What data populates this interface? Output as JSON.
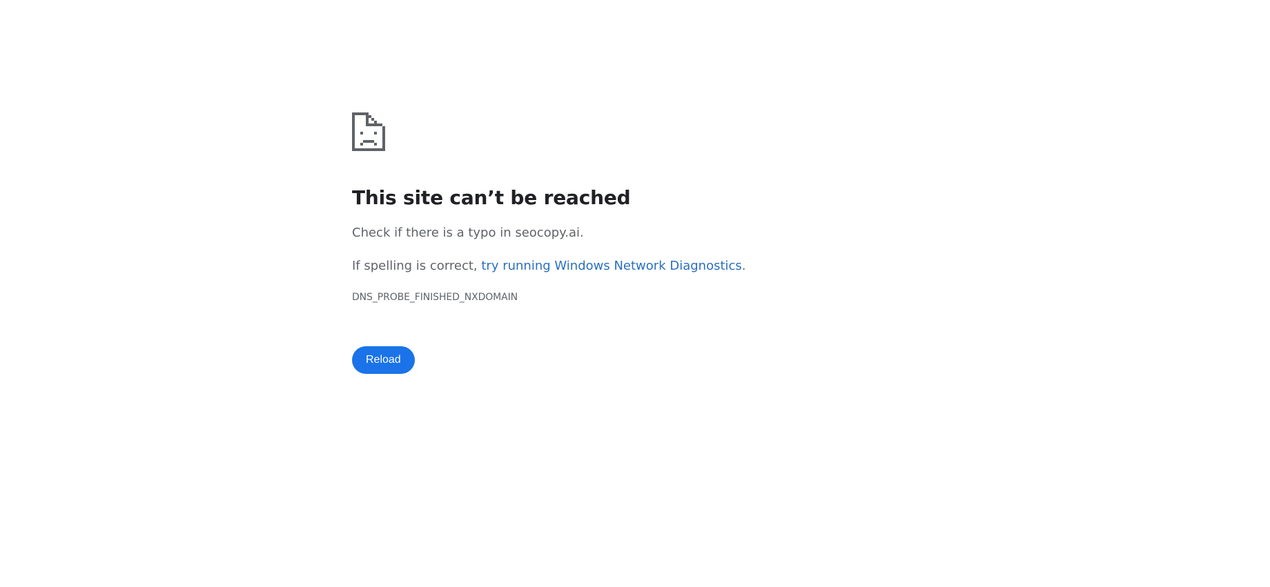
{
  "error": {
    "icon": "sad-document-icon",
    "title": "This site can’t be reached",
    "message_typo": "Check if there is a typo in seocopy.ai.",
    "message_spelling_prefix": "If spelling is correct, ",
    "diagnostics_link": "try running Windows Network Diagnostics",
    "message_spelling_suffix": ".",
    "error_code": "DNS_PROBE_FINISHED_NXDOMAIN"
  },
  "actions": {
    "reload_label": "Reload"
  },
  "colors": {
    "title": "#202124",
    "text": "#5f6368",
    "link": "#2a6fbf",
    "button": "#1a73e8",
    "icon": "#5f6368"
  }
}
